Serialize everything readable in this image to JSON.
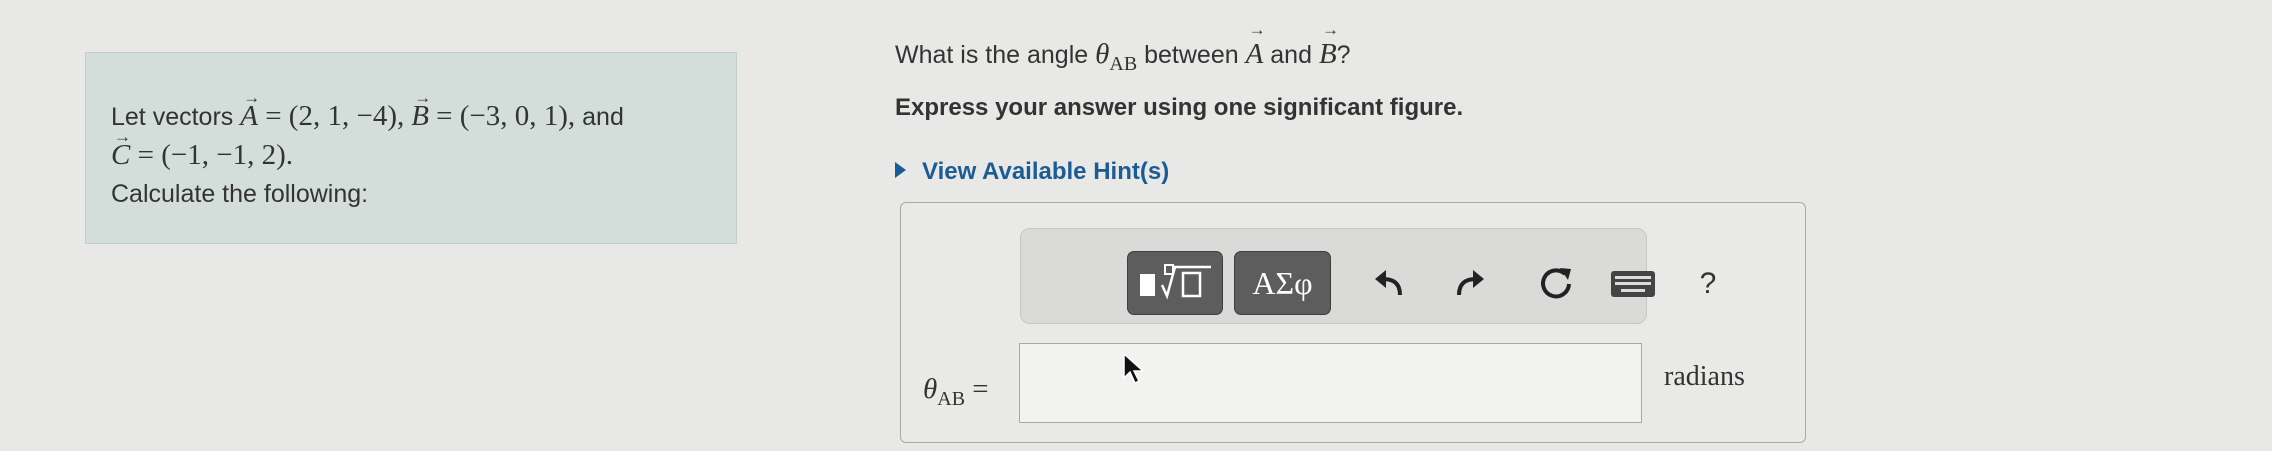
{
  "problem": {
    "intro": "Let vectors",
    "vec_a_name": "A",
    "vec_a_value": "= (2, 1, −4),",
    "vec_b_name": "B",
    "vec_b_value": "= (−3, 0, 1),",
    "and": "and",
    "vec_c_name": "C",
    "vec_c_value": "= (−1, −1, 2).",
    "instruction": "Calculate the following:"
  },
  "question": {
    "prefix": "What is the angle",
    "theta": "θ",
    "theta_sub": "AB",
    "between": "between",
    "vec_a": "A",
    "and": "and",
    "vec_b": "B",
    "suffix": "?",
    "instruction": "Express your answer using one significant figure.",
    "hint_label": "View Available Hint(s)"
  },
  "toolbar": {
    "symbols_label": "ΑΣφ",
    "help_label": "?",
    "icons": [
      "templates-icon",
      "undo-icon",
      "redo-icon",
      "reset-icon",
      "keyboard-icon",
      "help-icon"
    ]
  },
  "answer": {
    "label_theta": "θ",
    "label_sub": "AB",
    "label_equals": "=",
    "value": "",
    "units": "radians"
  },
  "colors": {
    "problem_bg": "#d3dedb",
    "hint_link": "#1c5c95",
    "toolbar_button": "#5d5d5d"
  }
}
